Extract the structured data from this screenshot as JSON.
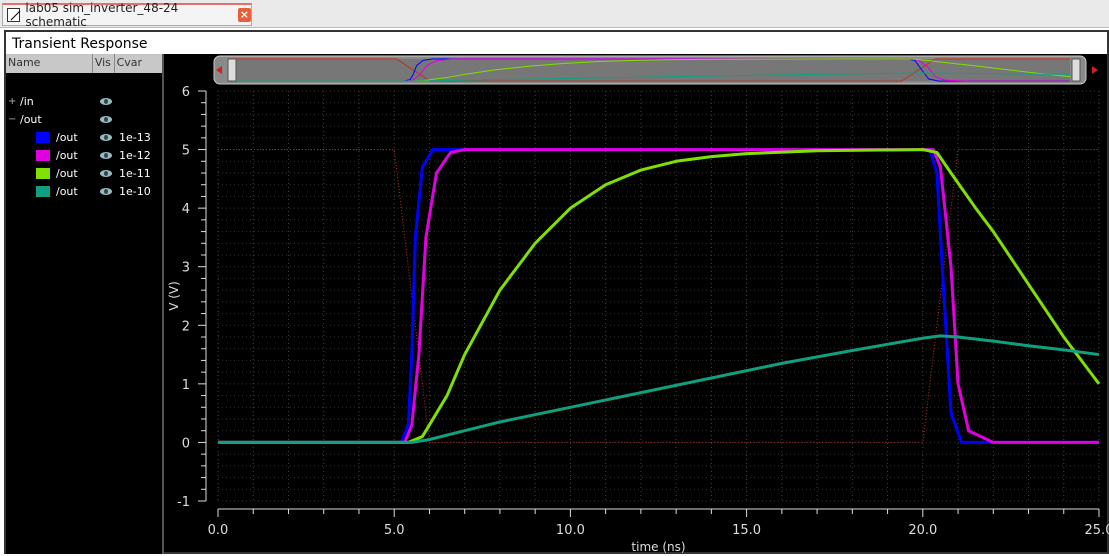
{
  "tab": {
    "title": "lab05 sim_inverter_48-24 schematic",
    "close": "×"
  },
  "window": {
    "title": "Transient Response"
  },
  "browser": {
    "headers": [
      "Name",
      "Vis",
      "Cvar"
    ],
    "items": [
      {
        "label": "/in",
        "expander": "+",
        "cvar": ""
      },
      {
        "label": "/out",
        "expander": "−",
        "cvar": ""
      },
      {
        "label": "/out",
        "color": "#0000ff",
        "cvar": "1e-13"
      },
      {
        "label": "/out",
        "color": "#e000e0",
        "cvar": "1e-12"
      },
      {
        "label": "/out",
        "color": "#80e000",
        "cvar": "1e-11"
      },
      {
        "label": "/out",
        "color": "#10a080",
        "cvar": "1e-10"
      }
    ]
  },
  "chart_data": {
    "type": "line",
    "xlabel": "time (ns)",
    "ylabel": "V (V)",
    "xlim": [
      0,
      25
    ],
    "ylim": [
      -1,
      6
    ],
    "xticks": [
      "0.0",
      "5.0",
      "10.0",
      "15.0",
      "20.0",
      "25.0"
    ],
    "yticks": [
      "-1",
      "0",
      "1",
      "2",
      "3",
      "4",
      "5",
      "6"
    ],
    "grid": true,
    "series": [
      {
        "signal": "/in",
        "color": "#c03020",
        "style": "dotted",
        "points": [
          [
            0,
            5
          ],
          [
            5,
            5
          ],
          [
            6,
            0
          ],
          [
            20,
            0
          ],
          [
            21,
            5
          ],
          [
            25,
            5
          ]
        ]
      },
      {
        "signal": "/out",
        "cvar": "1e-13",
        "color": "#0000ff",
        "points": [
          [
            0,
            0
          ],
          [
            5.2,
            0
          ],
          [
            5.4,
            0.3
          ],
          [
            5.5,
            1.5
          ],
          [
            5.6,
            3.5
          ],
          [
            5.8,
            4.7
          ],
          [
            6.1,
            5
          ],
          [
            20.2,
            5
          ],
          [
            20.4,
            4.6
          ],
          [
            20.6,
            2.5
          ],
          [
            20.8,
            0.5
          ],
          [
            21.1,
            0
          ],
          [
            25,
            0
          ]
        ]
      },
      {
        "signal": "/out",
        "cvar": "1e-12",
        "color": "#e000e0",
        "points": [
          [
            0,
            0
          ],
          [
            5.3,
            0
          ],
          [
            5.5,
            0.3
          ],
          [
            5.7,
            1.5
          ],
          [
            5.9,
            3.5
          ],
          [
            6.2,
            4.6
          ],
          [
            6.6,
            4.95
          ],
          [
            7,
            5
          ],
          [
            20.3,
            5
          ],
          [
            20.5,
            4.7
          ],
          [
            20.8,
            3
          ],
          [
            21,
            1
          ],
          [
            21.3,
            0.2
          ],
          [
            22,
            0
          ],
          [
            25,
            0
          ]
        ]
      },
      {
        "signal": "/out",
        "cvar": "1e-11",
        "color": "#80e000",
        "points": [
          [
            0,
            0
          ],
          [
            5.4,
            0
          ],
          [
            5.8,
            0.1
          ],
          [
            6.5,
            0.8
          ],
          [
            7,
            1.5
          ],
          [
            8,
            2.6
          ],
          [
            9,
            3.4
          ],
          [
            10,
            4
          ],
          [
            11,
            4.4
          ],
          [
            12,
            4.65
          ],
          [
            13,
            4.8
          ],
          [
            14,
            4.88
          ],
          [
            15,
            4.93
          ],
          [
            17,
            4.98
          ],
          [
            20,
            5
          ],
          [
            20.4,
            4.95
          ],
          [
            20.8,
            4.6
          ],
          [
            21.5,
            4
          ],
          [
            22,
            3.6
          ],
          [
            23,
            2.7
          ],
          [
            24,
            1.8
          ],
          [
            25,
            1.0
          ]
        ]
      },
      {
        "signal": "/out",
        "cvar": "1e-10",
        "color": "#10a080",
        "points": [
          [
            0,
            0
          ],
          [
            5.5,
            0
          ],
          [
            6,
            0.05
          ],
          [
            7,
            0.2
          ],
          [
            8,
            0.35
          ],
          [
            10,
            0.6
          ],
          [
            12,
            0.85
          ],
          [
            14,
            1.1
          ],
          [
            16,
            1.35
          ],
          [
            18,
            1.57
          ],
          [
            20,
            1.78
          ],
          [
            20.5,
            1.82
          ],
          [
            21,
            1.8
          ],
          [
            22,
            1.73
          ],
          [
            23,
            1.65
          ],
          [
            24,
            1.58
          ],
          [
            25,
            1.5
          ]
        ]
      }
    ]
  }
}
